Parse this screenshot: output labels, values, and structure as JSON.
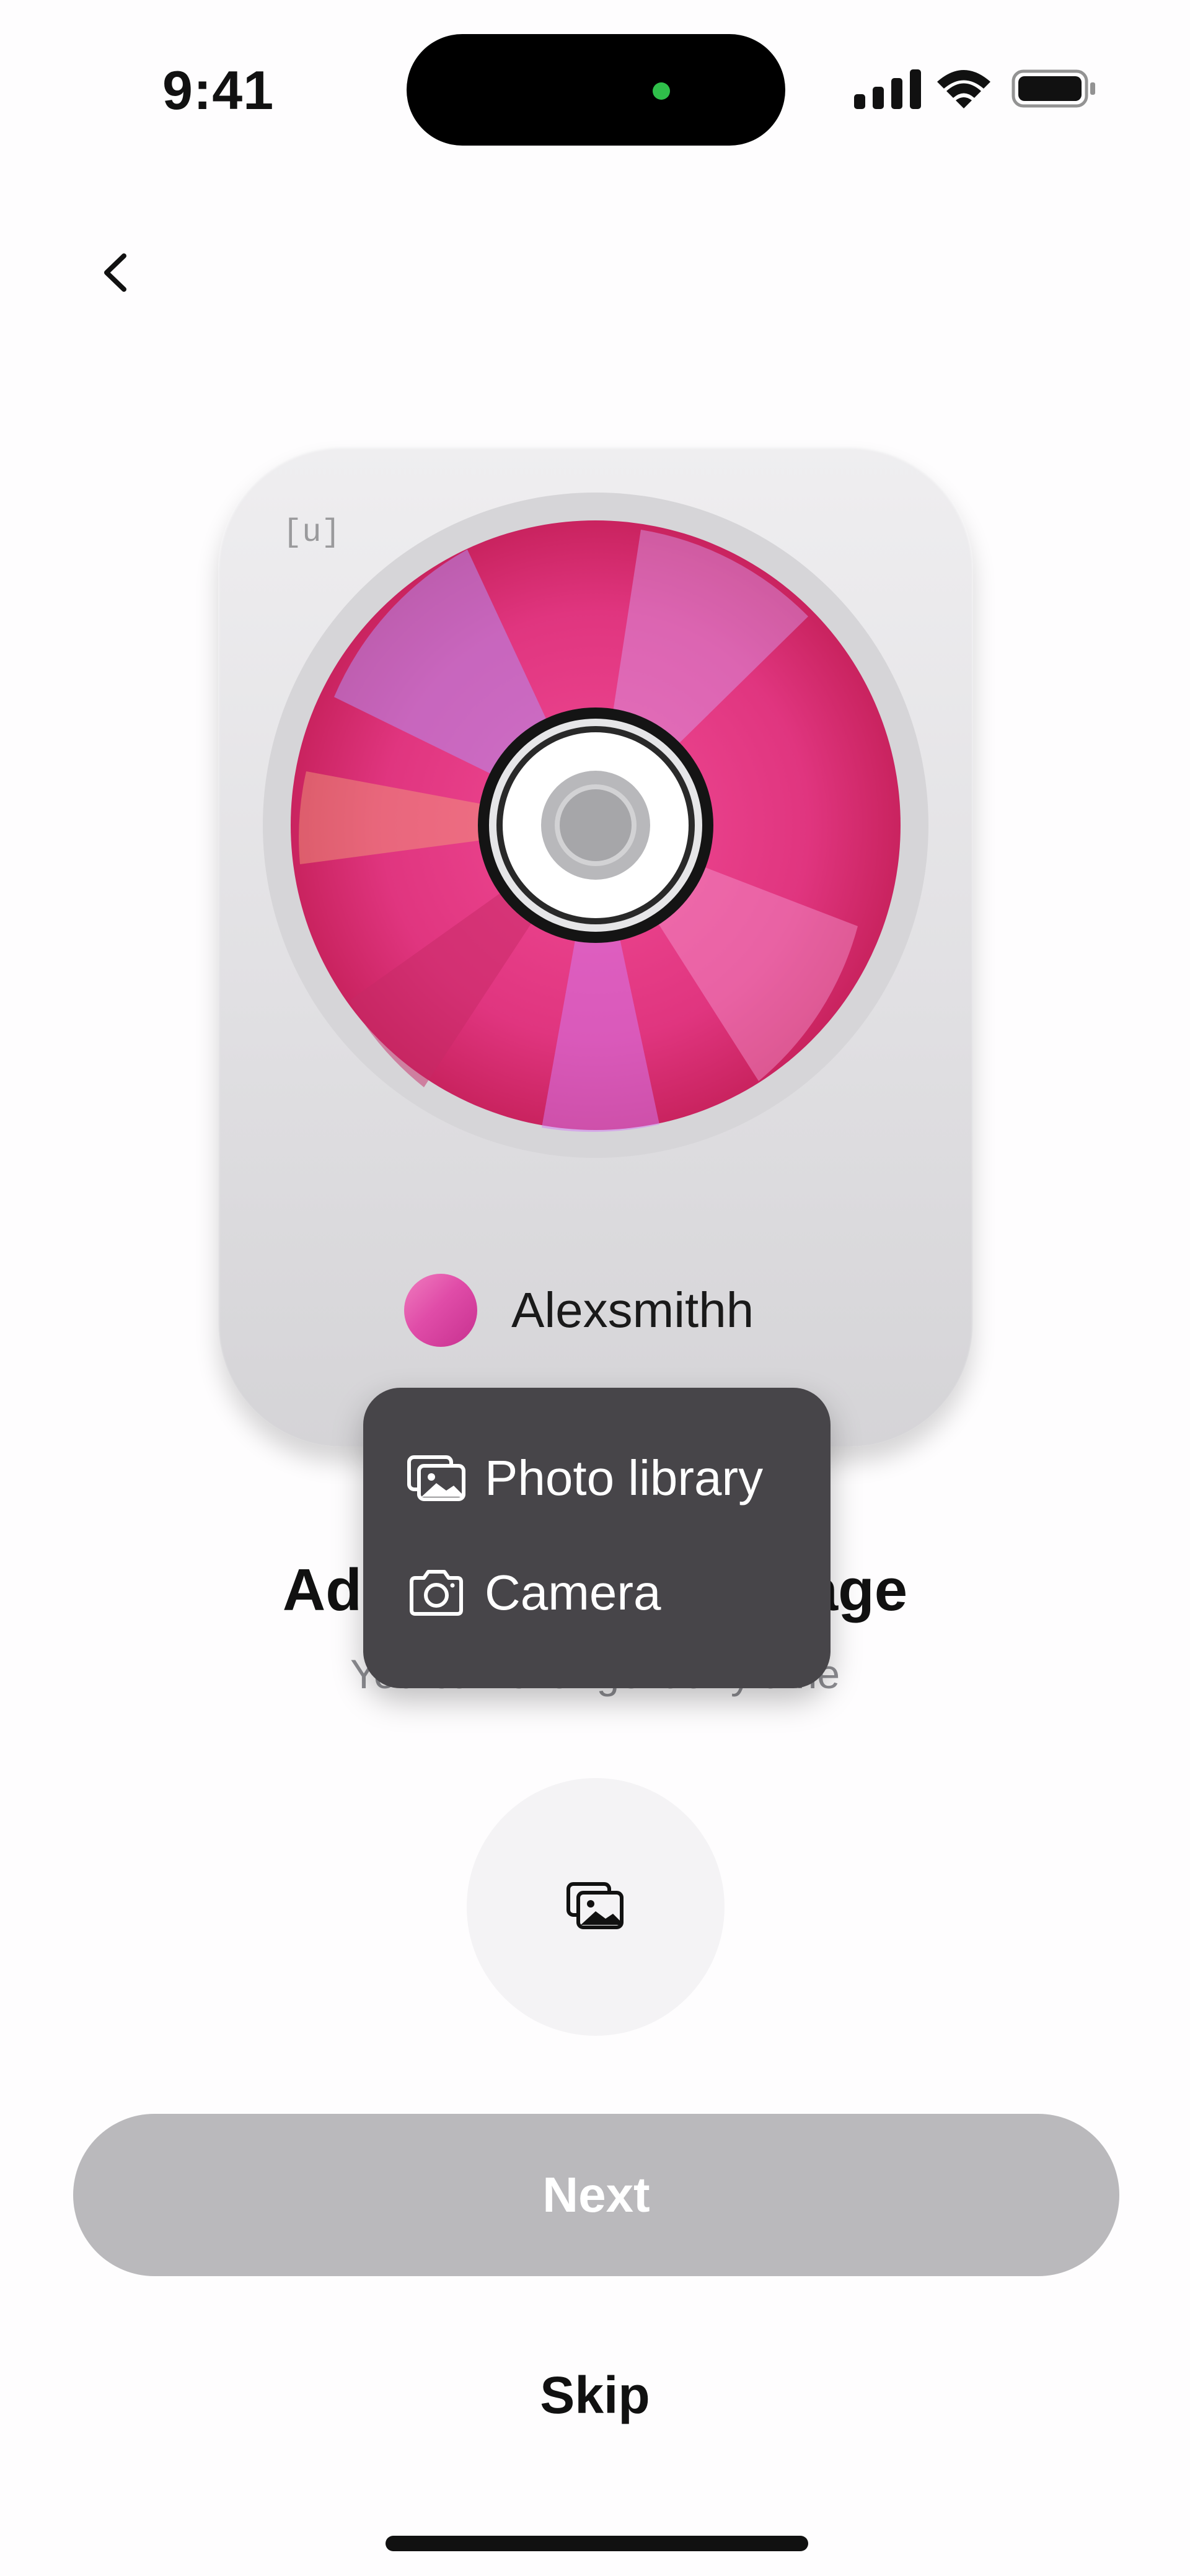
{
  "status_bar": {
    "time": "9:41",
    "icons": [
      "cellular-signal-icon",
      "wifi-icon",
      "battery-icon"
    ]
  },
  "nav": {
    "back_icon": "chevron-left-icon"
  },
  "card": {
    "tag": "[u]",
    "image": "cd-disc",
    "owner_name": "Alexsmithh"
  },
  "page": {
    "title": "Add your cover image",
    "subtitle": "You can change it any time"
  },
  "picker_menu": {
    "items": [
      {
        "label": "Photo library",
        "icon": "photo-library-icon"
      },
      {
        "label": "Camera",
        "icon": "camera-icon"
      }
    ]
  },
  "upload": {
    "icon": "photo-library-icon"
  },
  "actions": {
    "next_label": "Next",
    "skip_label": "Skip"
  },
  "colors": {
    "background": "#fefdfe",
    "disabled_button": "#bab9bc",
    "menu_background": "#474549",
    "disc_accent": "#e0357f"
  }
}
